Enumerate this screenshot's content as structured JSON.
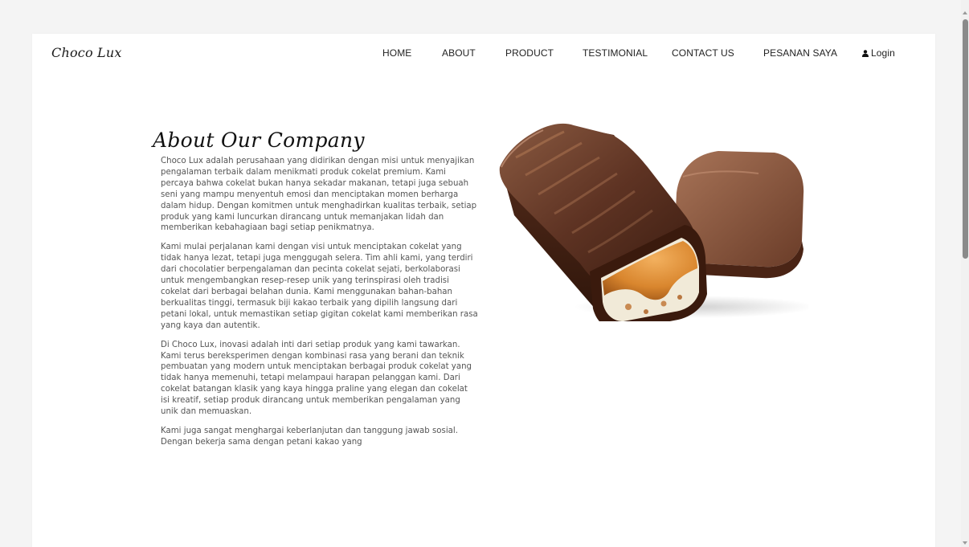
{
  "brand": "Choco Lux",
  "nav": {
    "home": "HOME",
    "about": "ABOUT",
    "product": "PRODUCT",
    "testimonial": "TESTIMONIAL",
    "contact": "CONTACT US",
    "orders": "PESANAN SAYA",
    "login": "Login",
    "login_icon": "user-icon"
  },
  "about": {
    "title": "About Our Company",
    "paragraphs": [
      "Choco Lux adalah perusahaan yang didirikan dengan misi untuk menyajikan pengalaman terbaik dalam menikmati produk cokelat premium. Kami percaya bahwa cokelat bukan hanya sekadar makanan, tetapi juga sebuah seni yang mampu menyentuh emosi dan menciptakan momen berharga dalam hidup. Dengan komitmen untuk menghadirkan kualitas terbaik, setiap produk yang kami luncurkan dirancang untuk memanjakan lidah dan memberikan kebahagiaan bagi setiap penikmatnya.",
      "Kami mulai perjalanan kami dengan visi untuk menciptakan cokelat yang tidak hanya lezat, tetapi juga menggugah selera. Tim ahli kami, yang terdiri dari chocolatier berpengalaman dan pecinta cokelat sejati, berkolaborasi untuk mengembangkan resep-resep unik yang terinspirasi oleh tradisi cokelat dari berbagai belahan dunia. Kami menggunakan bahan-bahan berkualitas tinggi, termasuk biji kakao terbaik yang dipilih langsung dari petani lokal, untuk memastikan setiap gigitan cokelat kami memberikan rasa yang kaya dan autentik.",
      "Di Choco Lux, inovasi adalah inti dari setiap produk yang kami tawarkan. Kami terus bereksperimen dengan kombinasi rasa yang berani dan teknik pembuatan yang modern untuk menciptakan berbagai produk cokelat yang tidak hanya memenuhi, tetapi melampaui harapan pelanggan kami. Dari cokelat batangan klasik yang kaya hingga praline yang elegan dan cokelat isi kreatif, setiap produk dirancang untuk memberikan pengalaman yang unik dan memuaskan.",
      "Kami juga sangat menghargai keberlanjutan dan tanggung jawab sosial. Dengan bekerja sama dengan petani kakao yang"
    ]
  },
  "colors": {
    "chocolate_dark": "#3b1d10",
    "chocolate_light": "#7a4a33",
    "caramel": "#d98a3a",
    "text": "#555555"
  }
}
